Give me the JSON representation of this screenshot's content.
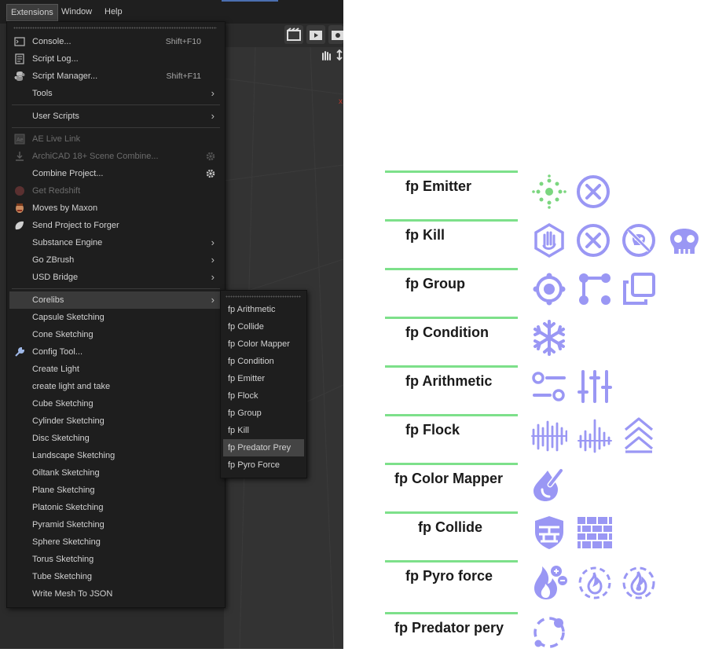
{
  "menubar": {
    "items": [
      "Extensions",
      "Window",
      "Help"
    ]
  },
  "main_menu": {
    "items": [
      {
        "label": "Console...",
        "shortcut": "Shift+F10",
        "icon": "console-icon"
      },
      {
        "label": "Script Log...",
        "icon": "script-log-icon"
      },
      {
        "label": "Script Manager...",
        "shortcut": "Shift+F11",
        "icon": "python-icon"
      },
      {
        "label": "Tools",
        "submenu": true
      },
      {
        "label": "User Scripts",
        "submenu": true
      },
      {
        "label": "AE Live Link",
        "disabled": true,
        "icon": "ae-icon"
      },
      {
        "label": "ArchiCAD 18+ Scene Combine...",
        "disabled": true,
        "icon": "import-icon",
        "gear": true
      },
      {
        "label": "Combine Project...",
        "gear": true
      },
      {
        "label": "Get Redshift",
        "disabled": true,
        "icon": "redshift-icon"
      },
      {
        "label": "Moves by Maxon",
        "icon": "moves-face-icon"
      },
      {
        "label": "Send Project to Forger",
        "icon": "forger-icon"
      },
      {
        "label": "Substance Engine",
        "submenu": true
      },
      {
        "label": "Go ZBrush",
        "submenu": true
      },
      {
        "label": "USD Bridge",
        "submenu": true
      },
      {
        "label": "Corelibs",
        "submenu": true,
        "highlighted": true
      },
      {
        "label": "Capsule Sketching"
      },
      {
        "label": "Cone Sketching"
      },
      {
        "label": "Config Tool...",
        "icon": "wrench-icon"
      },
      {
        "label": "Create Light"
      },
      {
        "label": "create light and take"
      },
      {
        "label": "Cube Sketching"
      },
      {
        "label": "Cylinder Sketching"
      },
      {
        "label": "Disc Sketching"
      },
      {
        "label": "Landscape Sketching"
      },
      {
        "label": "Oiltank Sketching"
      },
      {
        "label": "Plane Sketching"
      },
      {
        "label": "Platonic Sketching"
      },
      {
        "label": "Pyramid Sketching"
      },
      {
        "label": "Sphere Sketching"
      },
      {
        "label": "Torus Sketching"
      },
      {
        "label": "Tube Sketching"
      },
      {
        "label": "Write Mesh To JSON"
      }
    ]
  },
  "sub_menu": {
    "items": [
      "fp Arithmetic",
      "fp Collide",
      "fp Color Mapper",
      "fp Condition",
      "fp Emitter",
      "fp Flock",
      "fp Group",
      "fp Kill",
      "fp Predator Prey",
      "fp Pyro Force"
    ],
    "highlighted": "fp Predator Prey"
  },
  "legend": {
    "line_color": "#7de08a",
    "icon_color": "#9a97f4",
    "emitter_color": "#7bd67f",
    "rows": [
      {
        "label": "fp Emitter",
        "icons": [
          "particle-burst-icon",
          "circle-x-icon"
        ]
      },
      {
        "label": "fp Kill",
        "icons": [
          "hand-stop-icon",
          "circle-x-icon",
          "skull-forbidden-icon",
          "skull-icon"
        ]
      },
      {
        "label": "fp Group",
        "icons": [
          "target-circle-icon",
          "nodes-connect-icon",
          "copy-squares-icon"
        ]
      },
      {
        "label": "fp Condition",
        "icons": [
          "snowflake-icon"
        ]
      },
      {
        "label": "fp Arithmetic",
        "icons": [
          "toggle-sliders-icon",
          "mixer-sliders-icon"
        ]
      },
      {
        "label": "fp Flock",
        "icons": [
          "wave-bars-icon",
          "wave-bars-small-icon",
          "chevrons-up-icon"
        ]
      },
      {
        "label": "fp Color Mapper",
        "icons": [
          "color-picker-drop-icon"
        ]
      },
      {
        "label": "fp Collide",
        "icons": [
          "shield-wall-icon",
          "brick-wall-icon"
        ]
      },
      {
        "label": "fp Pyro force",
        "icons": [
          "flame-plus-minus-icon",
          "flame-dashed-icon",
          "flame-dashed-ring-icon"
        ]
      },
      {
        "label": "fp Predator pery",
        "icons": [
          "orbit-dots-icon"
        ]
      }
    ]
  }
}
